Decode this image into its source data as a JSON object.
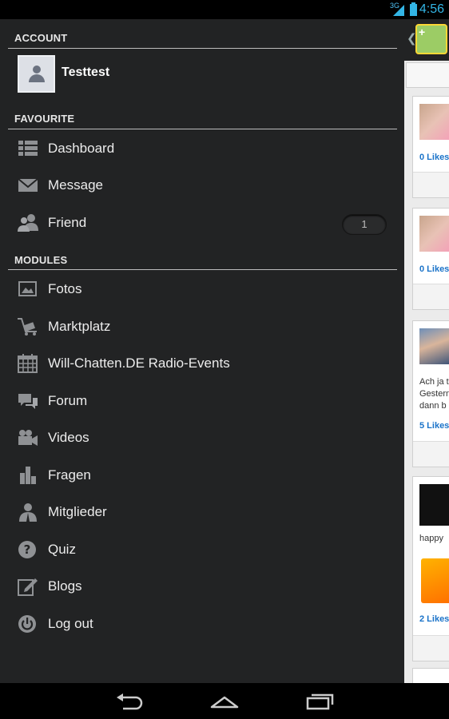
{
  "status": {
    "network": "3G",
    "time": "4:56"
  },
  "drawer": {
    "account_header": "ACCOUNT",
    "account_name": "Testtest",
    "favourite_header": "FAVOURITE",
    "favourites": [
      {
        "label": "Dashboard",
        "icon": "list-icon"
      },
      {
        "label": "Message",
        "icon": "envelope-icon"
      },
      {
        "label": "Friend",
        "icon": "friends-icon",
        "badge": "1"
      }
    ],
    "modules_header": "MODULES",
    "modules": [
      {
        "label": "Fotos",
        "icon": "photo-icon"
      },
      {
        "label": "Marktplatz",
        "icon": "cart-icon"
      },
      {
        "label": "Will-Chatten.DE Radio-Events",
        "icon": "calendar-icon"
      },
      {
        "label": "Forum",
        "icon": "chat-bubbles-icon"
      },
      {
        "label": "Videos",
        "icon": "video-camera-icon"
      },
      {
        "label": "Fragen",
        "icon": "bar-chart-icon"
      },
      {
        "label": "Mitglieder",
        "icon": "member-icon"
      },
      {
        "label": "Quiz",
        "icon": "question-icon"
      },
      {
        "label": "Blogs",
        "icon": "pencil-edit-icon"
      },
      {
        "label": "Log out",
        "icon": "power-icon"
      }
    ]
  },
  "feed": {
    "cards": [
      {
        "likes": "0 Likes"
      },
      {
        "likes": "0 Likes"
      },
      {
        "text1": "Ach ja t",
        "text2": "Gestern",
        "text3": "dann b",
        "likes": "5 Likes"
      },
      {
        "text1": "happy",
        "likes": "2 Likes"
      }
    ]
  },
  "colors": {
    "drawer_bg": "#222324",
    "accent": "#33b5e5",
    "link": "#1a73c9"
  }
}
